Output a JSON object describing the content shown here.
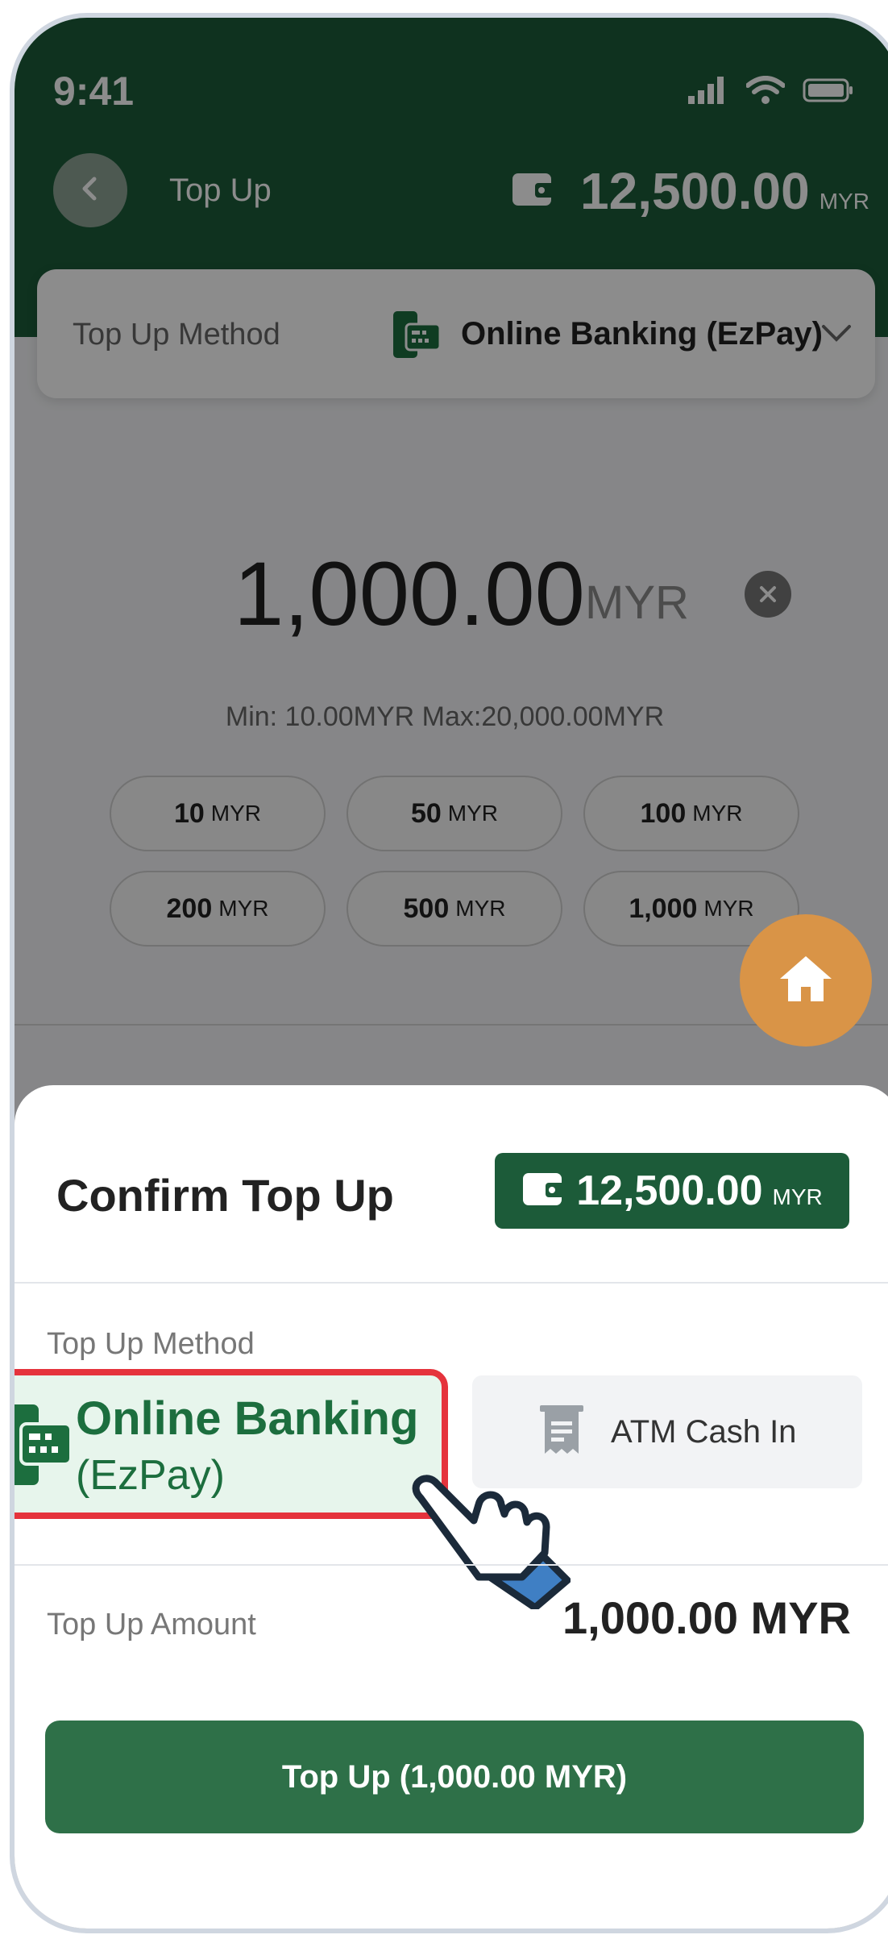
{
  "status_bar": {
    "time": "9:41"
  },
  "header": {
    "title": "Top Up",
    "balance": "12,500.00",
    "currency": "MYR"
  },
  "method_selector": {
    "label": "Top Up Method",
    "value": "Online Banking (EzPay)"
  },
  "amount_entry": {
    "amount": "1,000.00",
    "currency": "MYR",
    "limits": "Min: 10.00MYR   Max:20,000.00MYR",
    "quick_amounts": [
      {
        "value": "10",
        "currency": "MYR"
      },
      {
        "value": "50",
        "currency": "MYR"
      },
      {
        "value": "100",
        "currency": "MYR"
      },
      {
        "value": "200",
        "currency": "MYR"
      },
      {
        "value": "500",
        "currency": "MYR"
      },
      {
        "value": "1,000",
        "currency": "MYR"
      }
    ]
  },
  "confirm_sheet": {
    "title": "Confirm Top Up",
    "balance": "12,500.00",
    "currency": "MYR",
    "method_label": "Top Up Method",
    "options": [
      {
        "line1": "Online Banking",
        "line2": "(EzPay)",
        "selected": true,
        "icon": "card-terminal-icon"
      },
      {
        "label": "ATM Cash In",
        "selected": false,
        "icon": "receipt-icon"
      }
    ],
    "amount_label": "Top Up Amount",
    "amount_value": "1,000.00 MYR",
    "confirm_button": "Top Up (1,000.00 MYR)"
  },
  "colors": {
    "brand_green": "#1c5b39",
    "button_green": "#2e7048",
    "highlight_red": "#e5333c",
    "fab_orange": "#d99447"
  }
}
